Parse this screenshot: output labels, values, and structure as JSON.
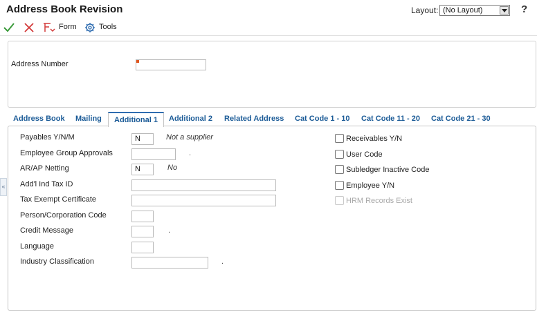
{
  "window": {
    "title": "Address Book Revision",
    "layout_label": "Layout:",
    "layout_value": "(No Layout)",
    "help": "?"
  },
  "toolbar": {
    "ok_icon": "checkmark-icon",
    "cancel_icon": "x-icon",
    "form_label": "Form",
    "tools_label": "Tools"
  },
  "header": {
    "address_number_label": "Address Number",
    "address_number_value": ""
  },
  "side_handle": "«",
  "tabs": [
    {
      "label": "Address Book"
    },
    {
      "label": "Mailing"
    },
    {
      "label": "Additional 1"
    },
    {
      "label": "Additional 2"
    },
    {
      "label": "Related Address"
    },
    {
      "label": "Cat Code 1 - 10"
    },
    {
      "label": "Cat Code 11 - 20"
    },
    {
      "label": "Cat Code 21 - 30"
    }
  ],
  "active_tab": "Additional 1",
  "fields": {
    "payables": {
      "label": "Payables Y/N/M",
      "value": "N",
      "note": "Not a supplier"
    },
    "employee_group": {
      "label": "Employee Group Approvals",
      "value": "",
      "note": "."
    },
    "ar_ap_netting": {
      "label": "AR/AP Netting",
      "value": "N",
      "note": "No"
    },
    "addl_ind_tax_id": {
      "label": "Add'l Ind Tax ID",
      "value": ""
    },
    "tax_exempt": {
      "label": "Tax Exempt Certificate",
      "value": ""
    },
    "person_corp": {
      "label": "Person/Corporation Code",
      "value": ""
    },
    "credit_message": {
      "label": "Credit Message",
      "value": "",
      "note": "."
    },
    "language": {
      "label": "Language",
      "value": ""
    },
    "industry_class": {
      "label": "Industry Classification",
      "value": "",
      "note": "."
    }
  },
  "checkboxes": [
    {
      "label": "Receivables Y/N",
      "checked": false,
      "enabled": true
    },
    {
      "label": "User Code",
      "checked": false,
      "enabled": true
    },
    {
      "label": "Subledger Inactive Code",
      "checked": false,
      "enabled": true
    },
    {
      "label": "Employee Y/N",
      "checked": false,
      "enabled": true
    },
    {
      "label": "HRM Records Exist",
      "checked": false,
      "enabled": false
    }
  ],
  "colors": {
    "tab_text": "#1b5b97",
    "ok_green": "#3a9a3a",
    "cancel_red": "#d33a3a",
    "required_marker": "#e0561f"
  }
}
